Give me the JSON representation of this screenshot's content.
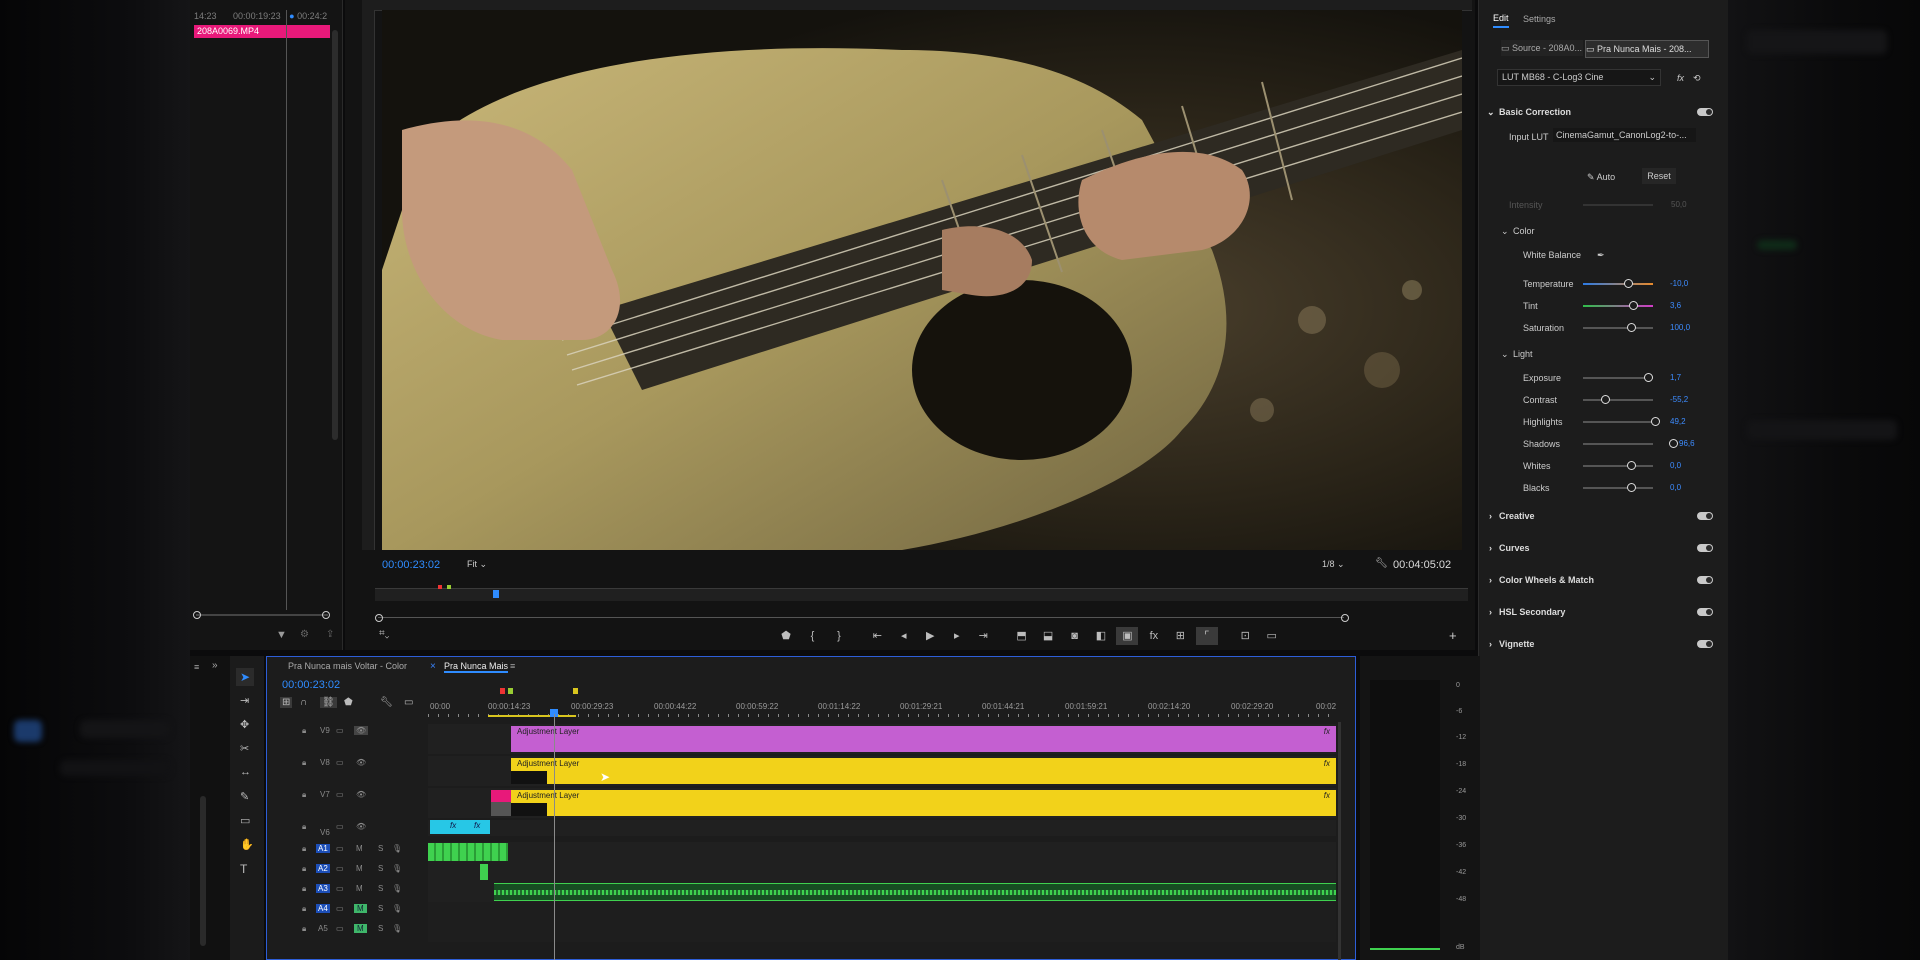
{
  "source_monitor": {
    "header_left": "14:23",
    "header_mid": "00:00:19:23",
    "header_right": "00:24:2",
    "clip_name": "208A0069.MP4"
  },
  "program_monitor": {
    "timecode": "00:00:23:02",
    "zoom": "Fit",
    "resolution": "1/8",
    "duration": "00:04:05:02"
  },
  "lumetri": {
    "tab_edit": "Edit",
    "tab_settings": "Settings",
    "source_tab": "Source - 208A0...",
    "seq_tab": "Pra Nunca Mais - 208...",
    "lut_preset": "LUT MB68 - C-Log3 Cine",
    "basic_correction": "Basic Correction",
    "input_lut_label": "Input LUT",
    "input_lut_value": "CinemaGamut_CanonLog2-to-...",
    "auto": "Auto",
    "reset": "Reset",
    "intensity_label": "Intensity",
    "intensity_value": "50,0",
    "color_section": "Color",
    "white_balance": "White Balance",
    "color_controls": [
      {
        "label": "Temperature",
        "value": "-10,0"
      },
      {
        "label": "Tint",
        "value": "3,6"
      },
      {
        "label": "Saturation",
        "value": "100,0"
      }
    ],
    "light_section": "Light",
    "light_controls": [
      {
        "label": "Exposure",
        "value": "1,7"
      },
      {
        "label": "Contrast",
        "value": "-55,2"
      },
      {
        "label": "Highlights",
        "value": "49,2"
      },
      {
        "label": "Shadows",
        "value": "96,6"
      },
      {
        "label": "Whites",
        "value": "0,0"
      },
      {
        "label": "Blacks",
        "value": "0,0"
      }
    ],
    "sections": [
      "Creative",
      "Curves",
      "Color Wheels & Match",
      "HSL Secondary",
      "Vignette"
    ]
  },
  "timeline": {
    "tab1": "Pra Nunca mais Voltar - Color",
    "tab2": "Pra Nunca Mais",
    "timecode": "00:00:23:02",
    "ruler_labels": [
      "00:00",
      "00:00:14:23",
      "00:00:29:23",
      "00:00:44:22",
      "00:00:59:22",
      "00:01:14:22",
      "00:01:29:21",
      "00:01:44:21",
      "00:01:59:21",
      "00:02:14:20",
      "00:02:29:20",
      "00:02"
    ],
    "video_tracks": [
      "V9",
      "V8",
      "V7",
      "V6"
    ],
    "audio_tracks": [
      "A1",
      "A2",
      "A3",
      "A4",
      "A5"
    ],
    "track_m": "M",
    "track_s": "S",
    "adjustment_label": "Adjustment Layer",
    "fx_label": "fx"
  },
  "left_panel_fragments": [
    "ted",
    "urati"
  ],
  "meter_scale": [
    "0",
    "-6",
    "-12",
    "-18",
    "-24",
    "-30",
    "-36",
    "-42",
    "-48",
    "dB"
  ],
  "colors": {
    "accent_blue": "#2f8cff",
    "clip_pink": "#e8197a",
    "adjustment_magenta": "#c45fd1",
    "adjustment_yellow": "#f2d21a",
    "audio_green": "#3fd14f",
    "cyan_clip": "#27c7e6"
  }
}
